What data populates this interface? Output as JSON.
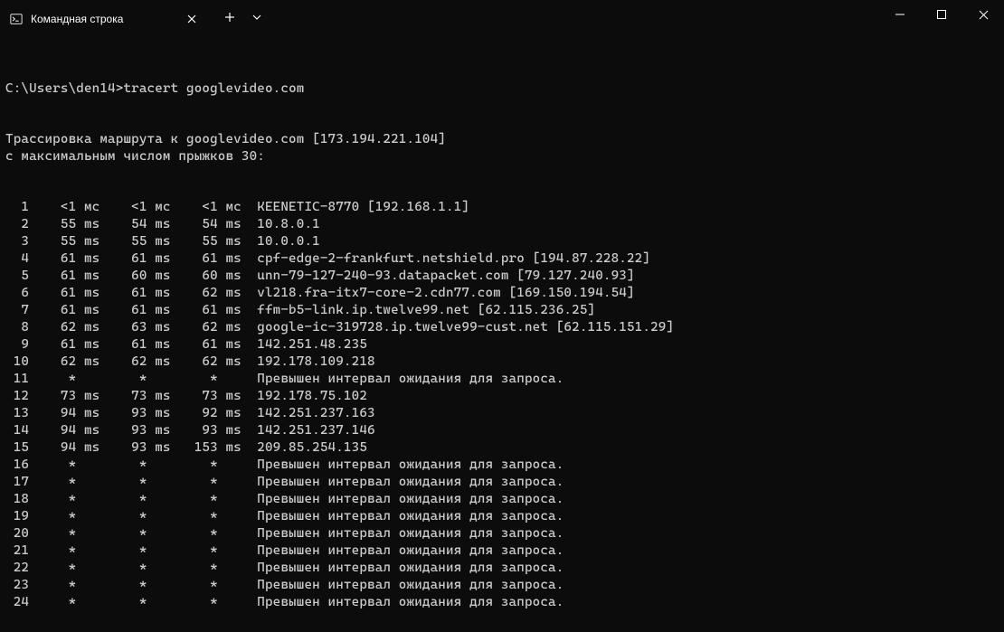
{
  "window": {
    "tab_title": "Командная строка"
  },
  "prompt": {
    "path": "C:\\Users\\den14>",
    "command": "tracert googlevideo.com"
  },
  "trace": {
    "line1": "Трассировка маршрута к googlevideo.com [173.194.221.104]",
    "line2": "с максимальным числом прыжков 30:"
  },
  "timeout_msg": "Превышен интервал ожидания для запроса.",
  "hops": [
    {
      "n": "1",
      "t1": "<1 мс",
      "t2": "<1 мс",
      "t3": "<1 мс",
      "host": "KEENETIC-8770 [192.168.1.1]"
    },
    {
      "n": "2",
      "t1": "55 ms",
      "t2": "54 ms",
      "t3": "54 ms",
      "host": "10.8.0.1"
    },
    {
      "n": "3",
      "t1": "55 ms",
      "t2": "55 ms",
      "t3": "55 ms",
      "host": "10.0.0.1"
    },
    {
      "n": "4",
      "t1": "61 ms",
      "t2": "61 ms",
      "t3": "61 ms",
      "host": "cpf-edge-2-frankfurt.netshield.pro [194.87.228.22]"
    },
    {
      "n": "5",
      "t1": "61 ms",
      "t2": "60 ms",
      "t3": "60 ms",
      "host": "unn-79-127-240-93.datapacket.com [79.127.240.93]"
    },
    {
      "n": "6",
      "t1": "61 ms",
      "t2": "61 ms",
      "t3": "62 ms",
      "host": "vl218.fra-itx7-core-2.cdn77.com [169.150.194.54]"
    },
    {
      "n": "7",
      "t1": "61 ms",
      "t2": "61 ms",
      "t3": "61 ms",
      "host": "ffm-b5-link.ip.twelve99.net [62.115.236.25]"
    },
    {
      "n": "8",
      "t1": "62 ms",
      "t2": "63 ms",
      "t3": "62 ms",
      "host": "google-ic-319728.ip.twelve99-cust.net [62.115.151.29]"
    },
    {
      "n": "9",
      "t1": "61 ms",
      "t2": "61 ms",
      "t3": "61 ms",
      "host": "142.251.48.235"
    },
    {
      "n": "10",
      "t1": "62 ms",
      "t2": "62 ms",
      "t3": "62 ms",
      "host": "192.178.109.218"
    },
    {
      "n": "11",
      "t1": "*",
      "t2": "*",
      "t3": "*",
      "host": "Превышен интервал ожидания для запроса."
    },
    {
      "n": "12",
      "t1": "73 ms",
      "t2": "73 ms",
      "t3": "73 ms",
      "host": "192.178.75.102"
    },
    {
      "n": "13",
      "t1": "94 ms",
      "t2": "93 ms",
      "t3": "92 ms",
      "host": "142.251.237.163"
    },
    {
      "n": "14",
      "t1": "94 ms",
      "t2": "93 ms",
      "t3": "93 ms",
      "host": "142.251.237.146"
    },
    {
      "n": "15",
      "t1": "94 ms",
      "t2": "93 ms",
      "t3": "153 ms",
      "host": "209.85.254.135"
    },
    {
      "n": "16",
      "t1": "*",
      "t2": "*",
      "t3": "*",
      "host": "Превышен интервал ожидания для запроса."
    },
    {
      "n": "17",
      "t1": "*",
      "t2": "*",
      "t3": "*",
      "host": "Превышен интервал ожидания для запроса."
    },
    {
      "n": "18",
      "t1": "*",
      "t2": "*",
      "t3": "*",
      "host": "Превышен интервал ожидания для запроса."
    },
    {
      "n": "19",
      "t1": "*",
      "t2": "*",
      "t3": "*",
      "host": "Превышен интервал ожидания для запроса."
    },
    {
      "n": "20",
      "t1": "*",
      "t2": "*",
      "t3": "*",
      "host": "Превышен интервал ожидания для запроса."
    },
    {
      "n": "21",
      "t1": "*",
      "t2": "*",
      "t3": "*",
      "host": "Превышен интервал ожидания для запроса."
    },
    {
      "n": "22",
      "t1": "*",
      "t2": "*",
      "t3": "*",
      "host": "Превышен интервал ожидания для запроса."
    },
    {
      "n": "23",
      "t1": "*",
      "t2": "*",
      "t3": "*",
      "host": "Превышен интервал ожидания для запроса."
    },
    {
      "n": "24",
      "t1": "*",
      "t2": "*",
      "t3": "*",
      "host": "Превышен интервал ожидания для запроса."
    }
  ]
}
